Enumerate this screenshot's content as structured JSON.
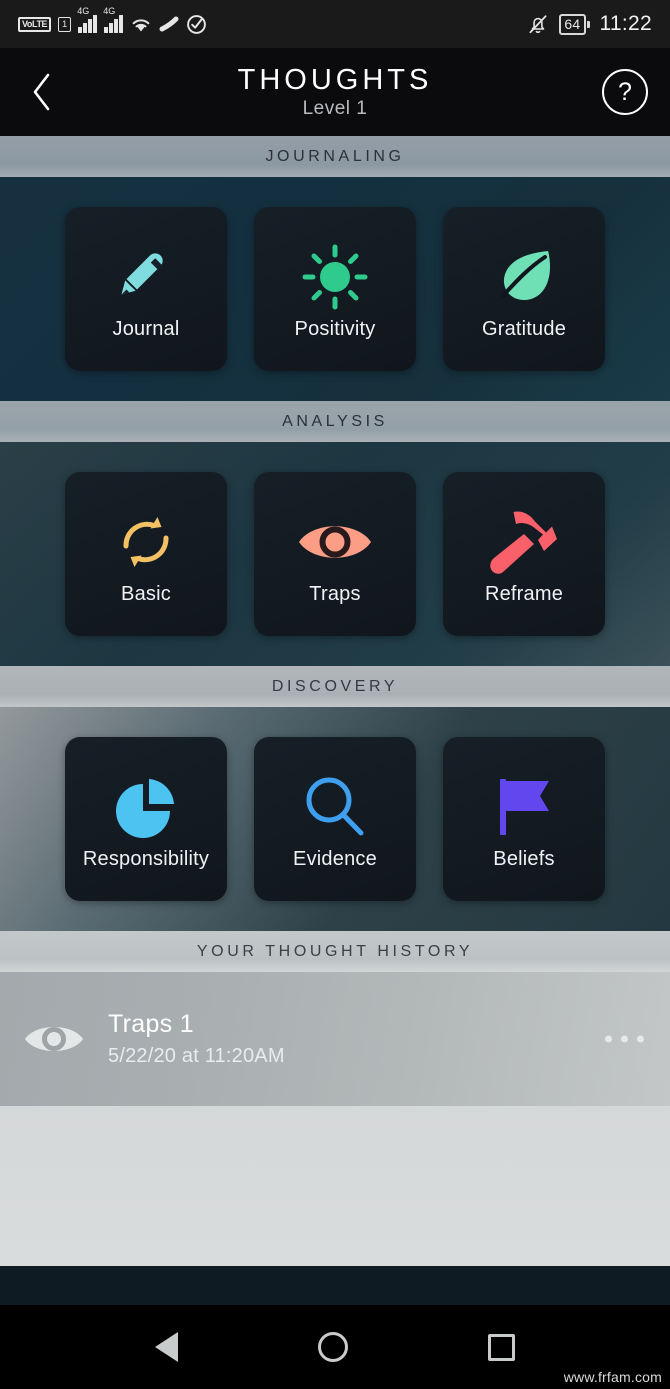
{
  "status_bar": {
    "volte_label": "VoLTE",
    "sim_label": "1",
    "network_1": "4G",
    "network_2": "4G",
    "battery_percent": "64",
    "time": "11:22"
  },
  "header": {
    "title": "THOUGHTS",
    "subtitle": "Level 1",
    "back_label": "‹",
    "help_label": "?"
  },
  "sections": [
    {
      "header": "JOURNALING",
      "tiles": [
        {
          "label": "Journal",
          "icon": "pencil-icon",
          "color": "#7fdde0"
        },
        {
          "label": "Positivity",
          "icon": "sun-icon",
          "color": "#2ecb8c"
        },
        {
          "label": "Gratitude",
          "icon": "leaf-icon",
          "color": "#6fdfb5"
        }
      ]
    },
    {
      "header": "ANALYSIS",
      "tiles": [
        {
          "label": "Basic",
          "icon": "refresh-cycle-icon",
          "color": "#f3c164"
        },
        {
          "label": "Traps",
          "icon": "eye-icon",
          "color": "#fb9e85"
        },
        {
          "label": "Reframe",
          "icon": "hammer-icon",
          "color": "#f9606a"
        }
      ]
    },
    {
      "header": "DISCOVERY",
      "tiles": [
        {
          "label": "Responsibility",
          "icon": "pie-chart-icon",
          "color": "#4cc3f0"
        },
        {
          "label": "Evidence",
          "icon": "magnifier-icon",
          "color": "#3e9ff0"
        },
        {
          "label": "Beliefs",
          "icon": "flag-icon",
          "color": "#6247ef"
        }
      ]
    }
  ],
  "history": {
    "header": "YOUR THOUGHT HISTORY",
    "entries": [
      {
        "title": "Traps 1",
        "timestamp": "5/22/20 at 11:20AM",
        "icon": "eye-icon"
      }
    ],
    "more_label": "⋯"
  },
  "nav_bar": {
    "back": "back-triangle-icon",
    "home": "home-circle-icon",
    "recents": "recents-square-icon"
  },
  "watermark": "www.frfam.com"
}
